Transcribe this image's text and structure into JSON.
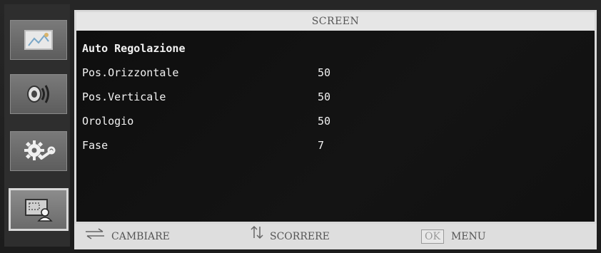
{
  "sidebar": {
    "tabs": [
      {
        "name": "picture-tab",
        "icon": "picture-icon"
      },
      {
        "name": "audio-tab",
        "icon": "speaker-icon"
      },
      {
        "name": "setup-tab",
        "icon": "gear-wrench-icon"
      },
      {
        "name": "screen-tab",
        "icon": "screen-icon",
        "active": true
      }
    ]
  },
  "panel": {
    "title": "SCREEN",
    "items": [
      {
        "label": "Auto Regolazione",
        "value": ""
      },
      {
        "label": "Pos.Orizzontale",
        "value": "50"
      },
      {
        "label": "Pos.Verticale",
        "value": "50"
      },
      {
        "label": "Orologio",
        "value": "50"
      },
      {
        "label": "Fase",
        "value": "7"
      }
    ]
  },
  "footer": {
    "change": {
      "icon": "swap-arrows-icon",
      "label": "CAMBIARE"
    },
    "scroll": {
      "icon": "up-down-arrows-icon",
      "label": "SCORRERE"
    },
    "menu": {
      "ok_label": "OK",
      "label": "MENU"
    }
  },
  "colors": {
    "panel_bg": "#121212",
    "title_bar": "#e6e6e6",
    "text": "#f2f2f2",
    "sidebar_tab": "#6a6a6a"
  }
}
